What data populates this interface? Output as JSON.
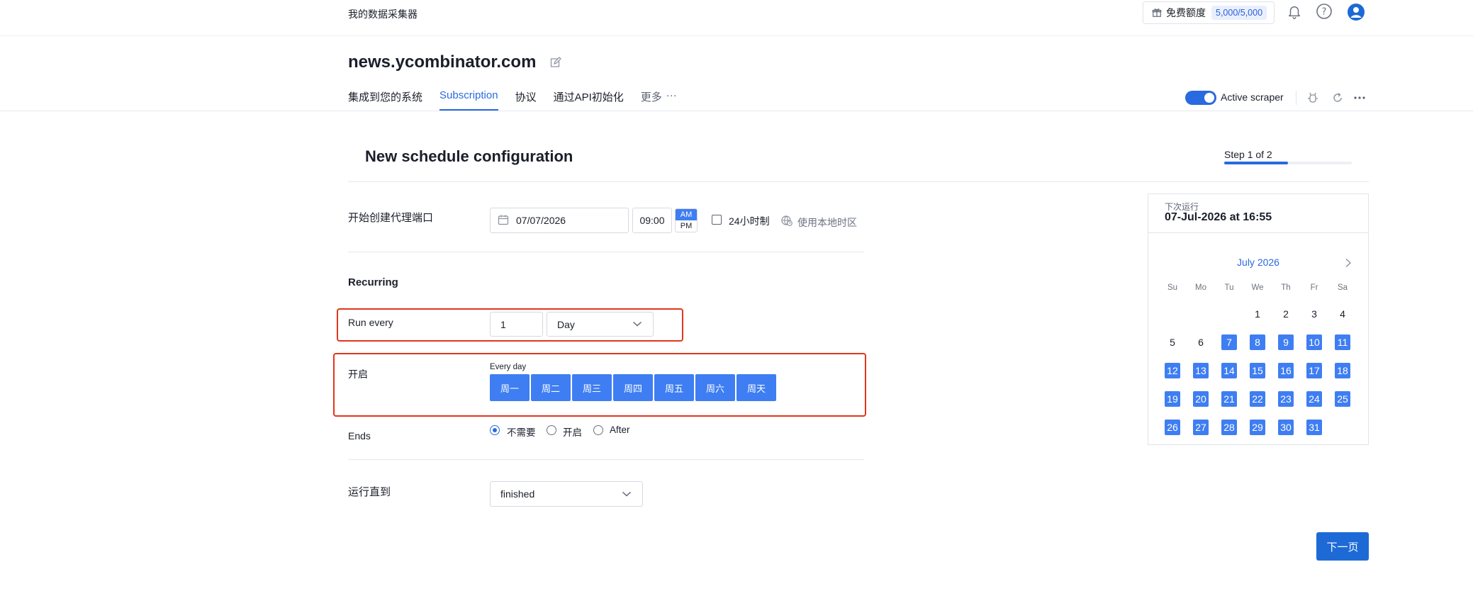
{
  "header": {
    "app_name": "我的数据采集器",
    "quota_label": "免费额度",
    "quota_count": "5,000/5,000"
  },
  "site": {
    "title": "news.ycombinator.com"
  },
  "tabs": [
    {
      "label": "集成到您的系统",
      "active": false
    },
    {
      "label": "Subscription",
      "active": true
    },
    {
      "label": "协议",
      "active": false
    },
    {
      "label": "通过API初始化",
      "active": false
    }
  ],
  "more_tab": {
    "label": "更多",
    "dots": "···"
  },
  "scraper": {
    "toggle_label": "Active scraper",
    "on": true
  },
  "config": {
    "title": "New schedule configuration",
    "step_label": "Step 1 of 2",
    "step_progress": 0.5
  },
  "start": {
    "label": "开始创建代理端口",
    "date": "07/07/2026",
    "time": "09:00",
    "am": "AM",
    "pm": "PM",
    "hour24_label": "24小时制",
    "local_tz_label": "使用本地时区"
  },
  "recurring": {
    "heading": "Recurring",
    "run_every_label": "Run every",
    "run_every_value": "1",
    "unit_value": "Day",
    "on_label": "开启",
    "every_day_hint": "Every day",
    "days": [
      "周一",
      "周二",
      "周三",
      "周四",
      "周五",
      "周六",
      "周天"
    ],
    "ends_label": "Ends",
    "ends_options": [
      {
        "label": "不需要",
        "selected": true
      },
      {
        "label": "开启",
        "selected": false
      },
      {
        "label": "After",
        "selected": false
      }
    ]
  },
  "run_until": {
    "label": "运行直到",
    "value": "finished"
  },
  "next_button": "下一页",
  "next_run": {
    "label": "下次运行",
    "value": "07-Jul-2026 at 16:55"
  },
  "calendar": {
    "month_label": "July 2026",
    "weekdays": [
      "Su",
      "Mo",
      "Tu",
      "We",
      "Th",
      "Fr",
      "Sa"
    ],
    "first_weekday_index": 3,
    "days_in_month": 31,
    "selected_from": 7
  },
  "colors": {
    "accent": "#2a6ae0",
    "day_fill": "#3f7ef2",
    "highlight": "#e1361b"
  }
}
